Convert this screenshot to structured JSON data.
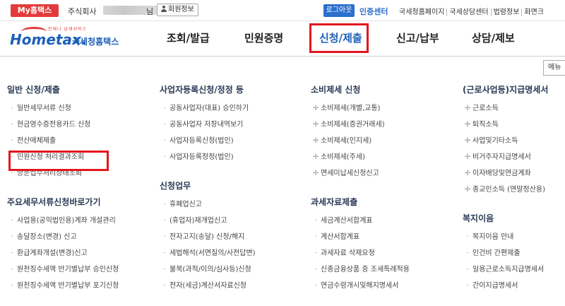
{
  "topbar": {
    "myhome": "My홈택스",
    "company": "주식회사",
    "nim": "님",
    "member": "회원정보",
    "logout": "로그아웃",
    "cert": "인증센터",
    "links": [
      "국세청홈페이지",
      "국세상담센터",
      "법령정보",
      "화면크"
    ]
  },
  "logo": {
    "sub": "언제나 납세서비스",
    "brand": "Hometax.",
    "kor": "국세청홈택스"
  },
  "nav": [
    "조회/발급",
    "민원증명",
    "신청/제출",
    "신고/납부",
    "상담/제보"
  ],
  "menu_button": "메뉴",
  "columns": [
    {
      "sections": [
        {
          "title": "일반 신청/제출",
          "style": "dot",
          "items": [
            "일반세무서류 신청",
            "현금영수증전용카드 신청",
            "전산매체제출",
            "민원신청 처리결과조회",
            "방문접수처리상태조회"
          ]
        },
        {
          "title": "주요세무서류신청바로가기",
          "style": "dot",
          "items": [
            "사업용(공익법인용)계좌 개설관리",
            "송달장소(변경) 신고",
            "환급계좌개설(변경)신고",
            "원천징수세액 반기별납부 승인신청",
            "원천징수세액 반기별납부 포기신청"
          ]
        }
      ]
    },
    {
      "sections": [
        {
          "title": "사업자등록신청/정정 등",
          "style": "dot",
          "items": [
            "공동사업자(대표) 승인하기",
            "공동사업자 저장내역보기",
            "사업자등록신청(법인)",
            "사업자등록정정(법인)"
          ]
        },
        {
          "title": "신청업무",
          "style": "dot",
          "items": [
            "휴폐업신고",
            "(휴업자)재개업신고",
            "전자고지(송달) 신청/해지",
            "세법해석(서면질의/사전답변)",
            "불복(과적/이의/심사등)신청",
            "전자(세금)계산서자료신청"
          ]
        }
      ]
    },
    {
      "sections": [
        {
          "title": "소비제세 신청",
          "style": "cross",
          "items": [
            "소비제세(개별,교통)",
            "소비제세(증권거래세)",
            "소비제세(인지세)",
            "소비제세(주세)",
            "면세미납세신청신고"
          ]
        },
        {
          "title": "과세자료제출",
          "style": "dot",
          "items": [
            "세금계산서합계표",
            "계산서합계표",
            "과세자료 삭제요청",
            "신종금융상품 중 조세특례적용",
            "연금수령개시및해지명세서"
          ]
        }
      ]
    },
    {
      "sections": [
        {
          "title": "(근로사업등)지급명세서",
          "style": "cross",
          "items": [
            "근로소득",
            "퇴직소득",
            "사업및기타소득",
            "비거주자지급명세서",
            "이자배당및연금계좌",
            "종교인소득 (연말정산용)"
          ]
        },
        {
          "title": "복지이음",
          "style": "dot",
          "items": [
            "복지이음 안내",
            "인건비 간편제출",
            "일용근로소득지급명세서",
            "간이지급명세서"
          ]
        }
      ]
    }
  ]
}
